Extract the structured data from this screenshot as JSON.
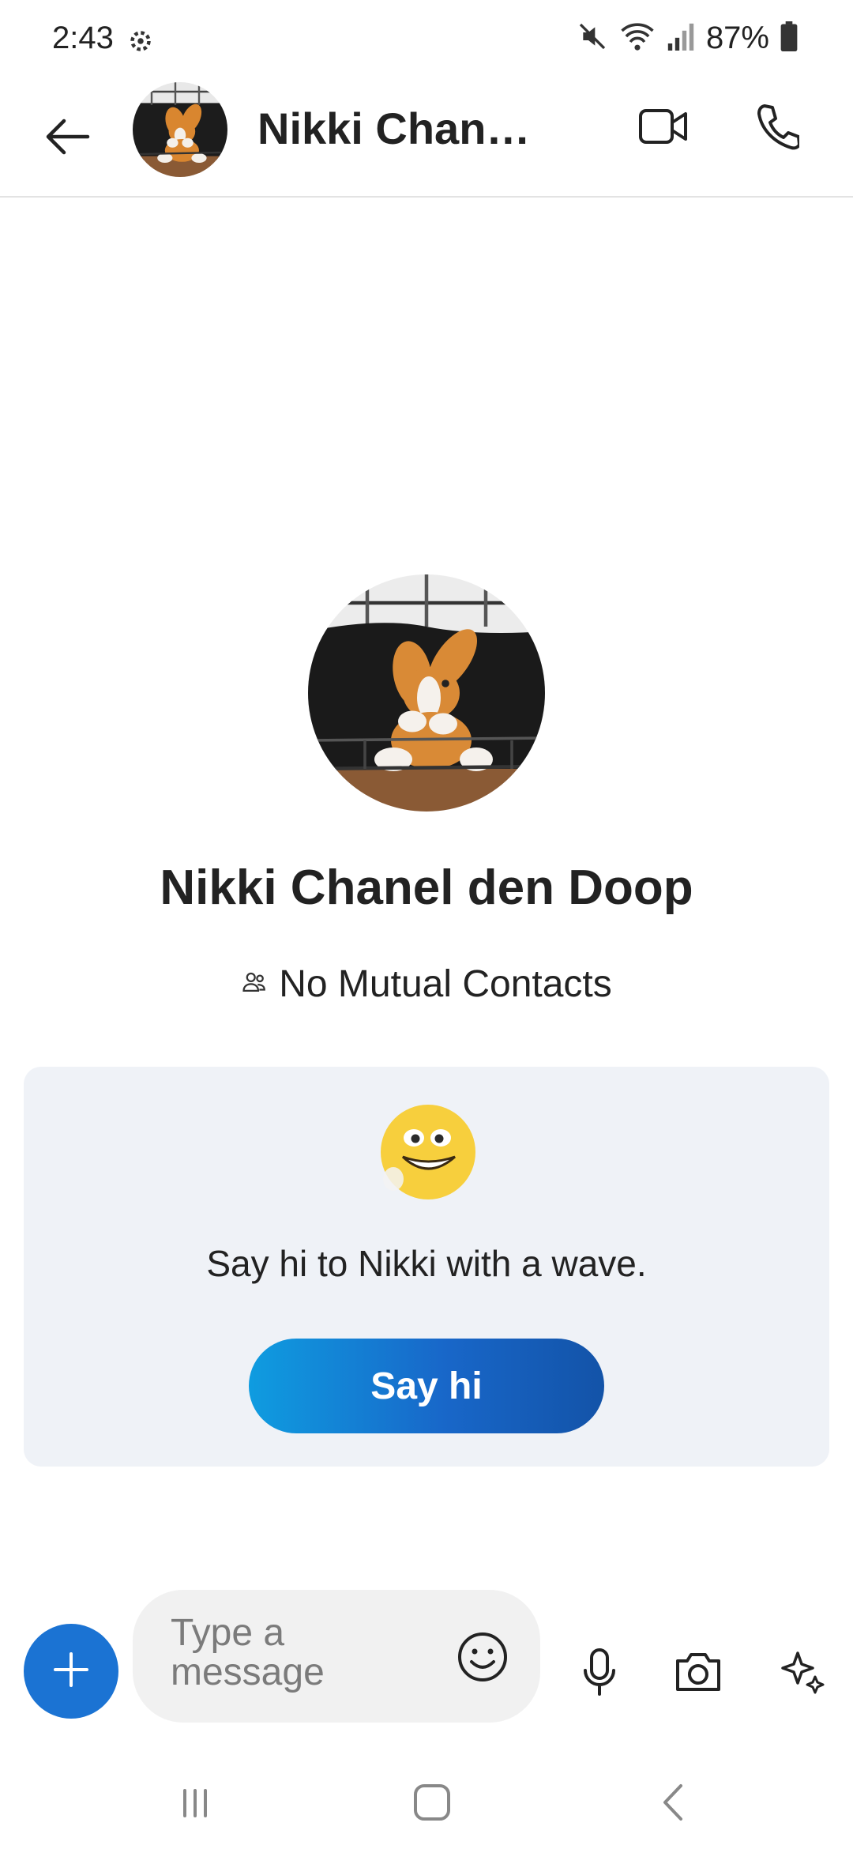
{
  "status_bar": {
    "time": "2:43",
    "battery": "87%",
    "icons": [
      "gear-icon",
      "mute-icon",
      "wifi-icon",
      "signal-icon",
      "battery-icon"
    ]
  },
  "header": {
    "contact_name": "Nikki Chan…",
    "icons": [
      "back-arrow-icon",
      "video-call-icon",
      "phone-icon"
    ]
  },
  "profile": {
    "name": "Nikki Chanel den Doop",
    "mutual_contacts": "No Mutual Contacts",
    "mutual_icon": "people-icon"
  },
  "wave_card": {
    "text": "Say hi to Nikki with a wave.",
    "button_label": "Say hi",
    "emoji": "waving-smiley-icon"
  },
  "composer": {
    "placeholder": "Type a message",
    "icons": [
      "plus-icon",
      "emoji-icon",
      "microphone-icon",
      "camera-icon",
      "sparkle-icon"
    ]
  },
  "colors": {
    "accent": "#1b73d3",
    "card_background": "#eff2f7",
    "button_gradient_start": "#0f9ce0",
    "button_gradient_end": "#1353a8"
  }
}
